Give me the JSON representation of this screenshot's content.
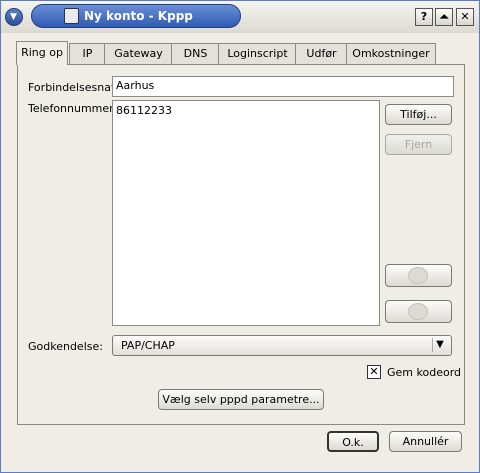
{
  "window": {
    "title": "Ny konto - Kppp",
    "help_btn": "?",
    "shade_btn": "⏶",
    "close_btn": "✕"
  },
  "tabs": [
    "Ring op",
    "IP",
    "Gateway",
    "DNS",
    "Loginscript",
    "Udfør",
    "Omkostninger"
  ],
  "form": {
    "connection_name_label": "Forbindelsesnavn:",
    "connection_name_value": "Aarhus",
    "phone_label": "Telefonnummer:",
    "phone_numbers": [
      "86112233"
    ],
    "add_btn": "Tilføj...",
    "remove_btn": "Fjern",
    "auth_label": "Godkendelse:",
    "auth_value": "PAP/CHAP",
    "store_password_label": "Gem kodeord",
    "store_password_checked": true,
    "pppd_btn": "Vælg selv pppd parametre..."
  },
  "footer": {
    "ok_btn": "O.k.",
    "cancel_btn": "Annullér"
  }
}
